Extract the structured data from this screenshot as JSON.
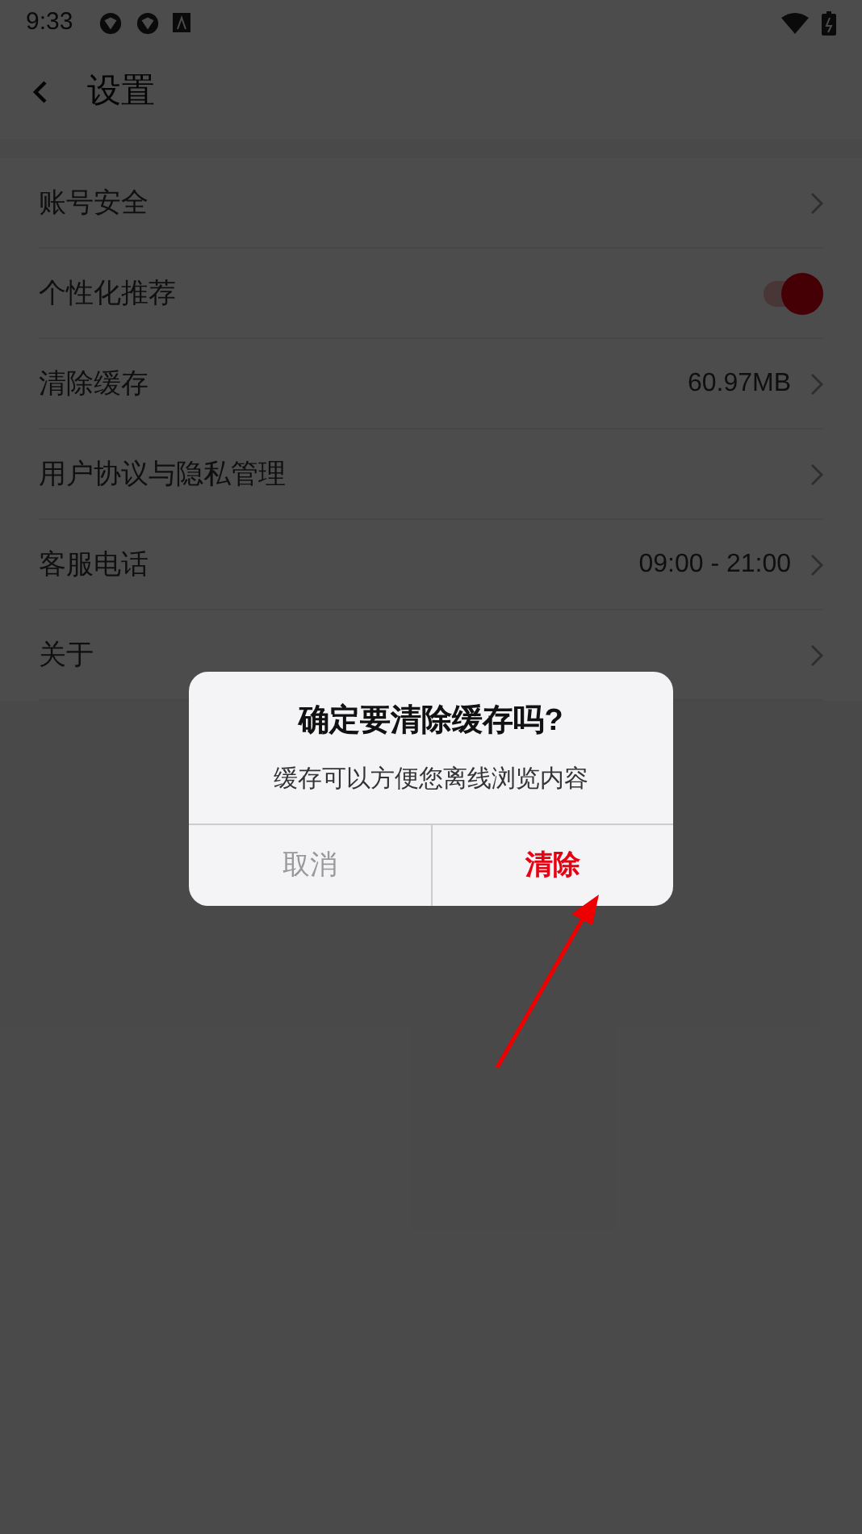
{
  "status_bar": {
    "time": "9:33"
  },
  "header": {
    "title": "设置"
  },
  "settings": [
    {
      "kind": "link",
      "label": "账号安全"
    },
    {
      "kind": "toggle",
      "label": "个性化推荐",
      "on": true
    },
    {
      "kind": "link",
      "label": "清除缓存",
      "value": "60.97MB"
    },
    {
      "kind": "link",
      "label": "用户协议与隐私管理"
    },
    {
      "kind": "link",
      "label": "客服电话",
      "value": "09:00 - 21:00"
    },
    {
      "kind": "link",
      "label": "关于"
    }
  ],
  "dialog": {
    "title": "确定要清除缓存吗?",
    "message": "缓存可以方便您离线浏览内容",
    "buttons": [
      {
        "label": "取消",
        "kind": "cancel"
      },
      {
        "label": "清除",
        "kind": "confirm"
      }
    ]
  }
}
